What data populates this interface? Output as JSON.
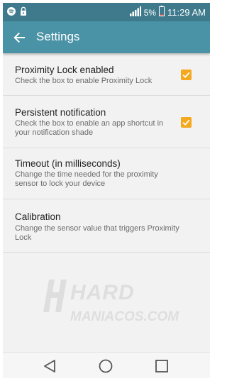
{
  "status_bar": {
    "battery_percent": "5%",
    "time": "11:29 AM",
    "icons": [
      "spotify-icon",
      "lock-icon",
      "signal-icon",
      "battery-icon"
    ]
  },
  "app_bar": {
    "title": "Settings",
    "back_icon": "arrow-back-icon"
  },
  "settings": [
    {
      "title": "Proximity Lock enabled",
      "summary": "Check the box to enable Proximity Lock",
      "checkbox": true,
      "checked": true
    },
    {
      "title": "Persistent notification",
      "summary": "Check the box to enable an app shortcut in your notification shade",
      "checkbox": true,
      "checked": true
    },
    {
      "title": "Timeout (in milliseconds)",
      "summary": "Change the time needed for the proximity sensor to lock your device",
      "checkbox": false
    },
    {
      "title": "Calibration",
      "summary": "Change the sensor value that triggers Proximity Lock",
      "checkbox": false
    }
  ],
  "watermark": {
    "line1": "HARD",
    "line2": "MANIACOS.COM"
  },
  "nav_bar": {
    "icons": [
      "back-triangle-icon",
      "home-circle-icon",
      "recents-square-icon"
    ]
  },
  "colors": {
    "status_bar": "#3e7a8c",
    "app_bar": "#4a92a6",
    "checkbox": "#f4a81d",
    "background": "#f2f2f2"
  }
}
